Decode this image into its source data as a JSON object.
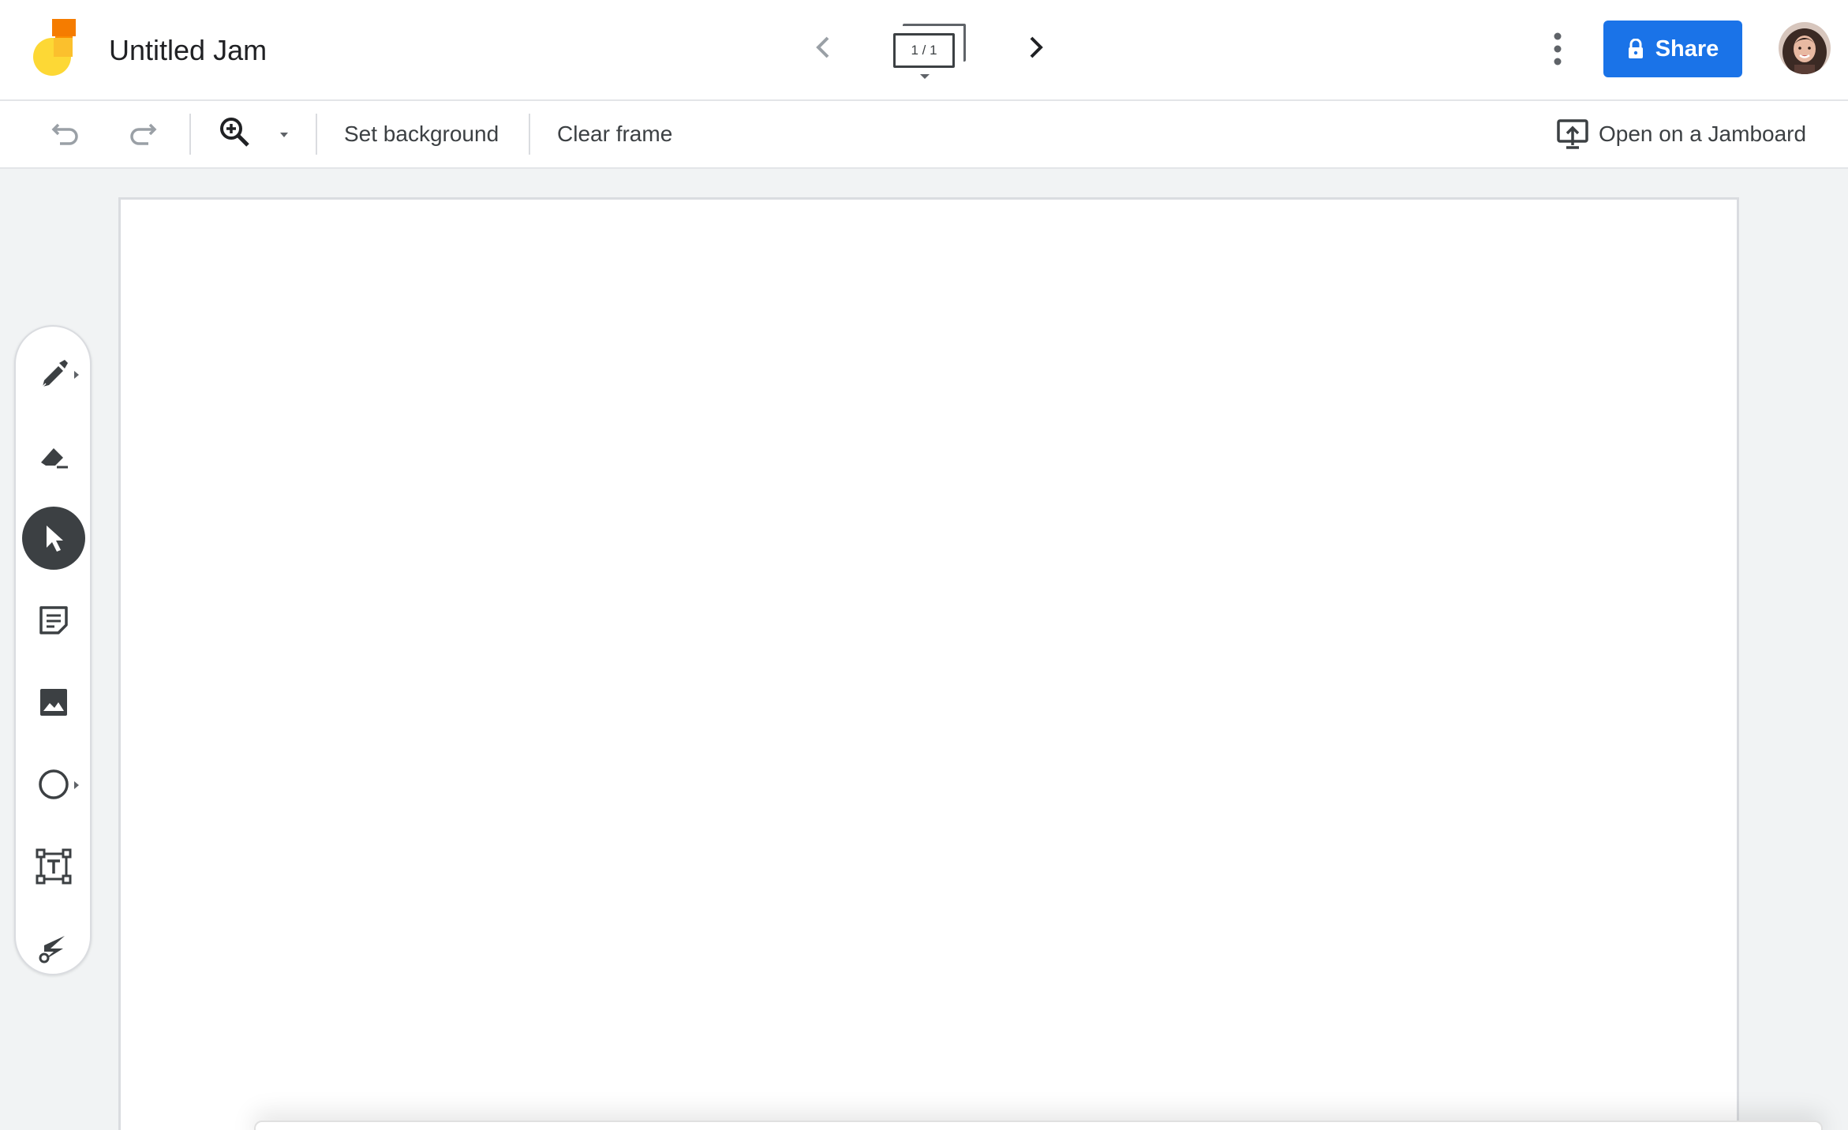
{
  "header": {
    "title": "Untitled Jam",
    "frame_indicator": "1 / 1",
    "share_label": "Share"
  },
  "toolbar": {
    "set_background_label": "Set background",
    "clear_frame_label": "Clear frame",
    "open_on_jamboard_label": "Open on a Jamboard"
  },
  "side_tools": [
    {
      "name": "pen",
      "icon": "pen-icon",
      "has_submenu": true
    },
    {
      "name": "eraser",
      "icon": "eraser-icon",
      "has_submenu": false
    },
    {
      "name": "select",
      "icon": "pointer-icon",
      "has_submenu": false,
      "active": true
    },
    {
      "name": "sticky-note",
      "icon": "sticky-note-icon",
      "has_submenu": false
    },
    {
      "name": "add-image",
      "icon": "image-icon",
      "has_submenu": false
    },
    {
      "name": "circle",
      "icon": "circle-icon",
      "has_submenu": true
    },
    {
      "name": "text-box",
      "icon": "text-box-icon",
      "has_submenu": false
    },
    {
      "name": "laser",
      "icon": "laser-icon",
      "has_submenu": false
    }
  ],
  "colors": {
    "brand_blue": "#1a73e8",
    "logo_orange": "#f57c00",
    "logo_yellow": "#fbc02d",
    "active_tool": "#3c4043",
    "icon_gray": "#5f6368"
  }
}
